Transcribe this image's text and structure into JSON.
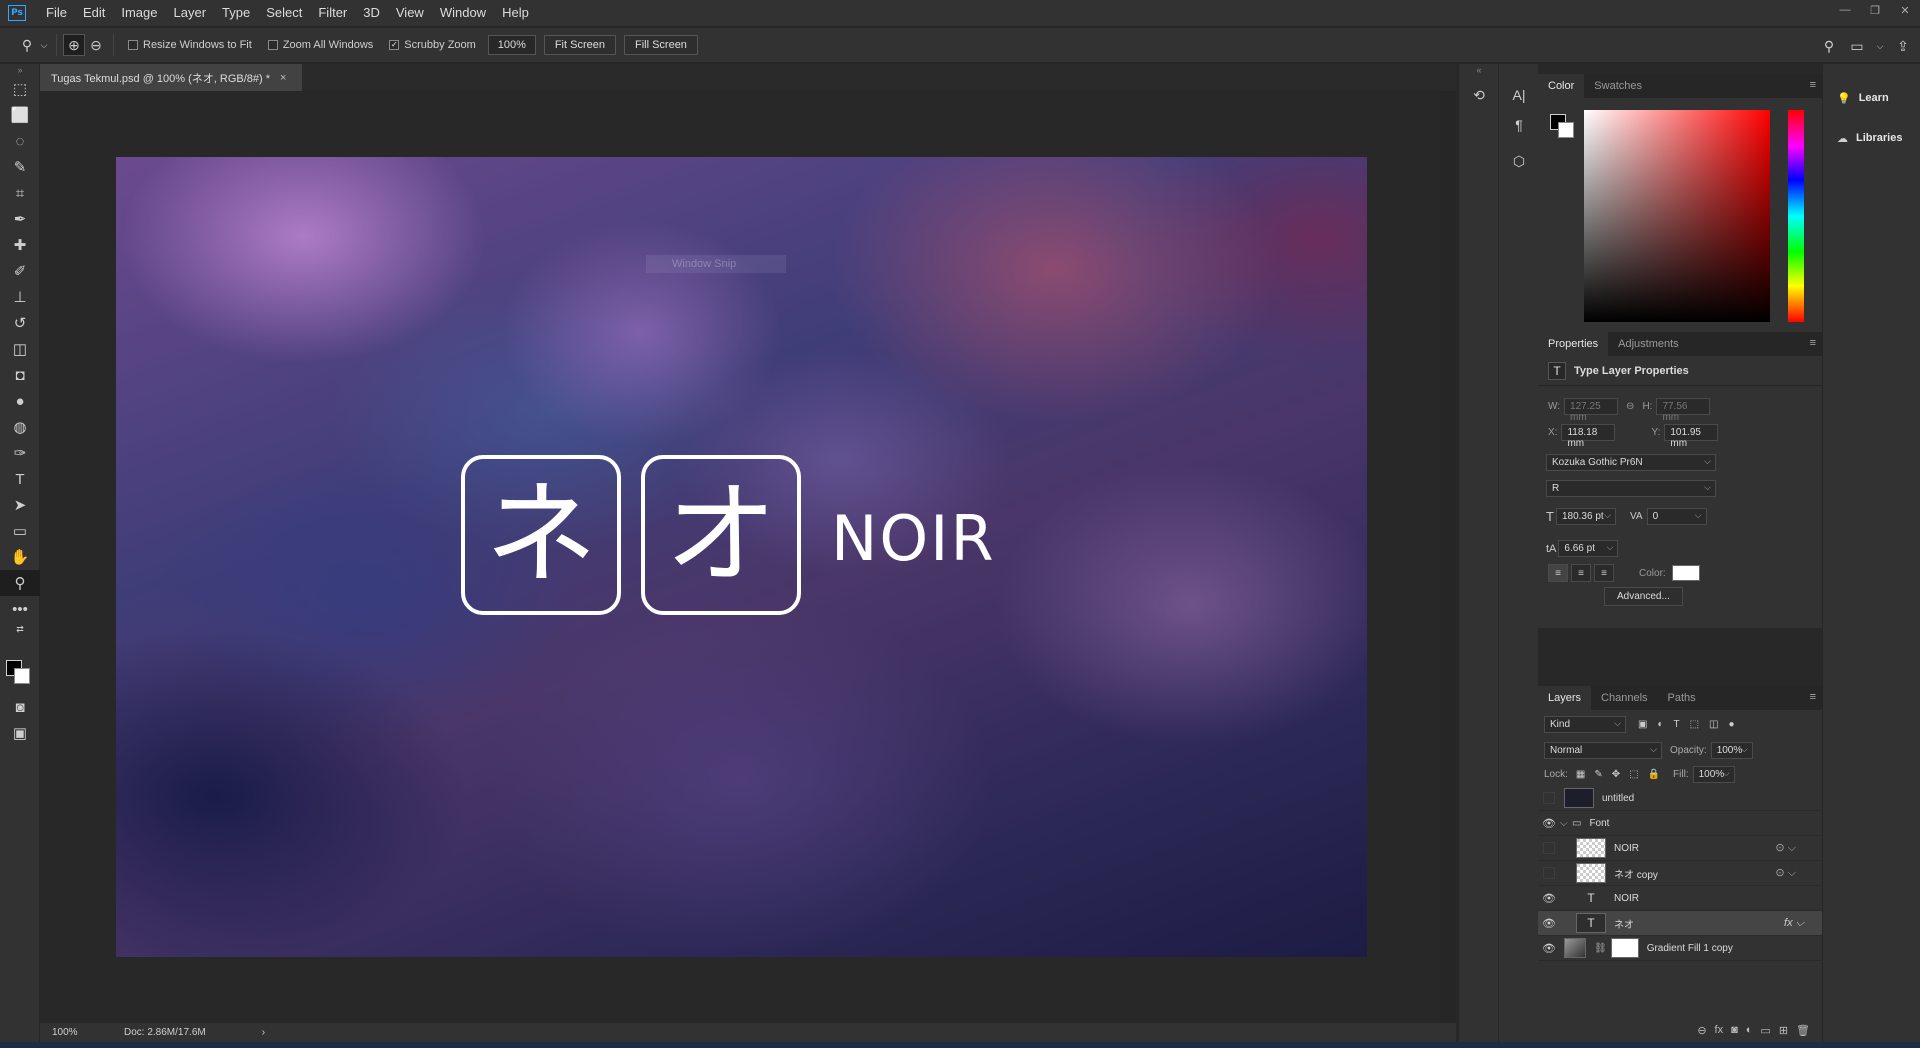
{
  "menubar": {
    "logo": "Ps",
    "items": [
      "File",
      "Edit",
      "Image",
      "Layer",
      "Type",
      "Select",
      "Filter",
      "3D",
      "View",
      "Window",
      "Help"
    ]
  },
  "options": {
    "resize_windows": "Resize Windows to Fit",
    "zoom_all": "Zoom All Windows",
    "scrubby_zoom": "Scrubby Zoom",
    "scrubby_checked": "✓",
    "zoom_value": "100%",
    "fit_screen": "Fit Screen",
    "fill_screen": "Fill Screen"
  },
  "document": {
    "tab_title": "Tugas Tekmul.psd @ 100% (ネオ, RGB/8#) *",
    "close": "×",
    "snip_label": "Window Snip",
    "glyph_ne": "ネ",
    "glyph_o": "オ",
    "noir": "NOIR"
  },
  "status": {
    "zoom": "100%",
    "doc": "Doc: 2.86M/17.6M"
  },
  "color_panel": {
    "tabs": [
      "Color",
      "Swatches"
    ],
    "foreground": "#000000",
    "background": "#ffffff"
  },
  "learn": {
    "learn_label": "Learn",
    "libraries_label": "Libraries"
  },
  "properties": {
    "tabs": [
      "Properties",
      "Adjustments"
    ],
    "title": "Type Layer Properties",
    "w_label": "W:",
    "w": "127.25 mm",
    "h_label": "H:",
    "h": "77.56 mm",
    "x_label": "X:",
    "x": "118.18 mm",
    "y_label": "Y:",
    "y": "101.95 mm",
    "font_family": "Kozuka Gothic Pr6N",
    "font_style": "R",
    "font_size": "180.36 pt",
    "tracking": "0",
    "leading": "6.66 pt",
    "color_label": "Color:",
    "advanced": "Advanced..."
  },
  "layers_panel": {
    "tabs": [
      "Layers",
      "Channels",
      "Paths"
    ],
    "filter_kind": "Kind",
    "blend_mode": "Normal",
    "opacity_label": "Opacity:",
    "opacity": "100%",
    "lock_label": "Lock:",
    "fill_label": "Fill:",
    "fill": "100%",
    "layers": [
      {
        "name": "untitled"
      },
      {
        "name": "Font"
      },
      {
        "name": "NOIR"
      },
      {
        "name": "ネオ copy"
      },
      {
        "name": "NOIR"
      },
      {
        "name": "ネオ"
      },
      {
        "name": "Gradient Fill 1 copy"
      }
    ]
  }
}
